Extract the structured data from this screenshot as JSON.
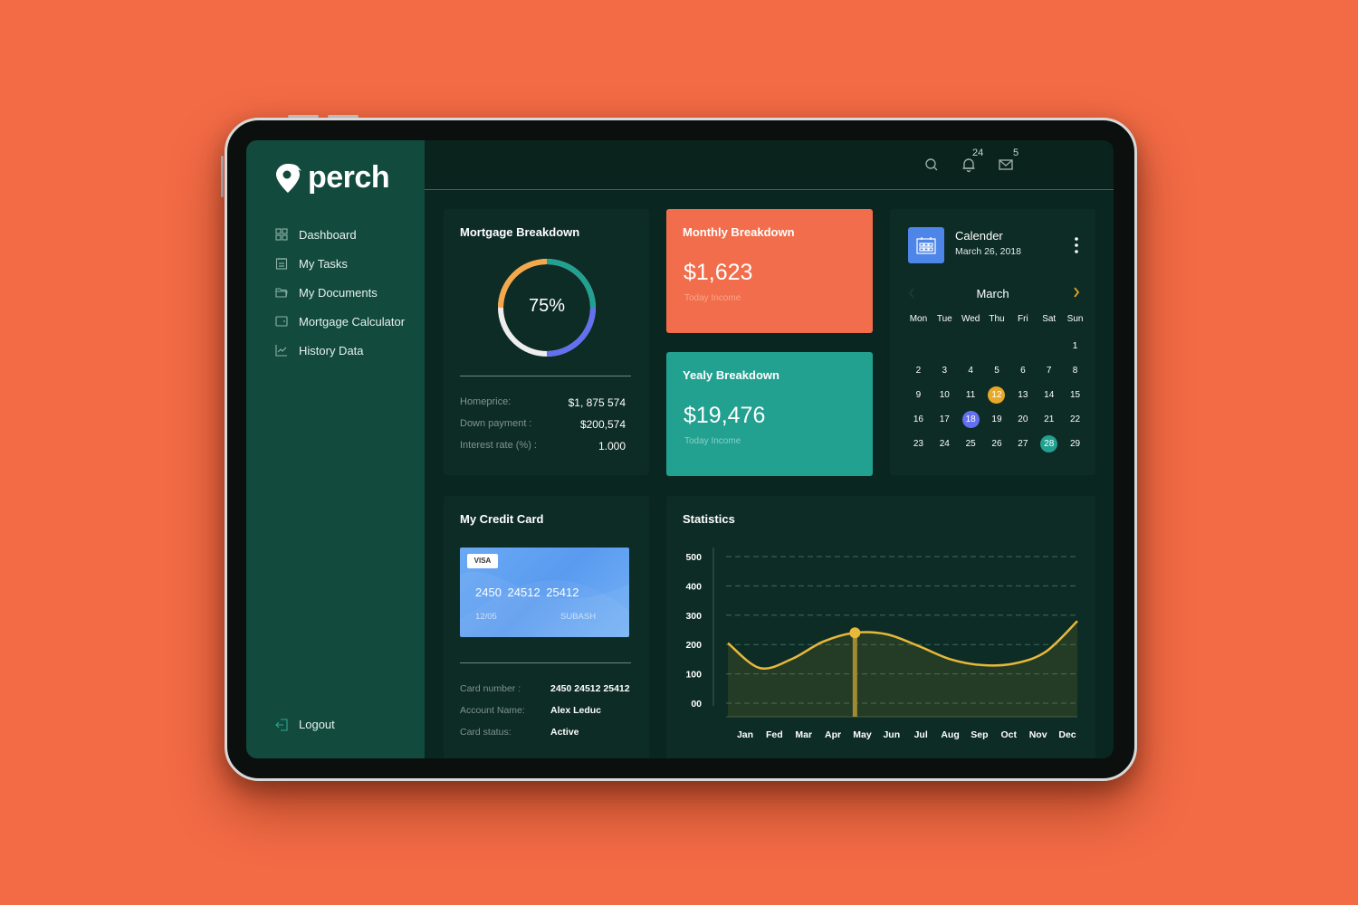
{
  "app": {
    "name": "perch"
  },
  "sidebar": {
    "items": [
      {
        "label": "Dashboard",
        "icon": "grid-icon"
      },
      {
        "label": "My Tasks",
        "icon": "clipboard-icon"
      },
      {
        "label": "My Documents",
        "icon": "folder-icon"
      },
      {
        "label": "Mortgage Calculator",
        "icon": "wallet-icon"
      },
      {
        "label": "History Data",
        "icon": "line-chart-icon"
      }
    ],
    "logout": "Logout"
  },
  "topbar": {
    "notifications_count": "24",
    "messages_count": "5"
  },
  "mortgage": {
    "title": "Mortgage Breakdown",
    "percent_label": "75%",
    "percent": 75,
    "segment_colors": [
      "#f5a84a",
      "#22a090",
      "#6370f0",
      "#eeeeee"
    ],
    "rows": [
      {
        "label": "Homeprice:",
        "value": "$1, 875 574"
      },
      {
        "label": "Down payment :",
        "value": "$200,574"
      },
      {
        "label": "Interest rate (%) :",
        "value": "1.000"
      }
    ]
  },
  "monthly": {
    "title": "Monthly Breakdown",
    "value": "$1,623",
    "sub": "Today Income"
  },
  "yearly": {
    "title": "Yealy Breakdown",
    "value": "$19,476",
    "sub": "Today Income"
  },
  "calendar": {
    "title": "Calender",
    "date": "March 26, 2018",
    "month": "March",
    "weekdays": [
      "Mon",
      "Tue",
      "Wed",
      "Thu",
      "Fri",
      "Sat",
      "Sun"
    ],
    "first_weekday_index": 6,
    "days_in_month": 29,
    "highlights": [
      {
        "day": 12,
        "color": "#e8a92a"
      },
      {
        "day": 18,
        "color": "#6370f0"
      },
      {
        "day": 28,
        "color": "#22a090"
      }
    ]
  },
  "credit_card": {
    "title": "My Credit Card",
    "brand": "VISA",
    "number_display": "2450  24512  25412",
    "expiry": "12/05",
    "holder": "SUBASH",
    "rows": [
      {
        "label": "Card number :",
        "value": "2450 24512 25412"
      },
      {
        "label": "Account Name:",
        "value": "Alex Leduc"
      },
      {
        "label": "Card status:",
        "value": "Active"
      }
    ]
  },
  "chart_data": {
    "type": "area",
    "title": "Statistics",
    "categories": [
      "Jan",
      "Fed",
      "Mar",
      "Apr",
      "May",
      "Jun",
      "Jul",
      "Aug",
      "Sep",
      "Oct",
      "Nov",
      "Dec"
    ],
    "series": [
      {
        "name": "Statistics",
        "values": [
          205,
          120,
          150,
          210,
          240,
          235,
          195,
          150,
          130,
          135,
          175,
          280
        ],
        "color": "#e8b83a"
      }
    ],
    "highlight_index": 4,
    "y_ticks": [
      "00",
      "100",
      "200",
      "300",
      "400",
      "500"
    ],
    "ylim": [
      0,
      500
    ],
    "grid": true,
    "xlabel": "",
    "ylabel": ""
  }
}
